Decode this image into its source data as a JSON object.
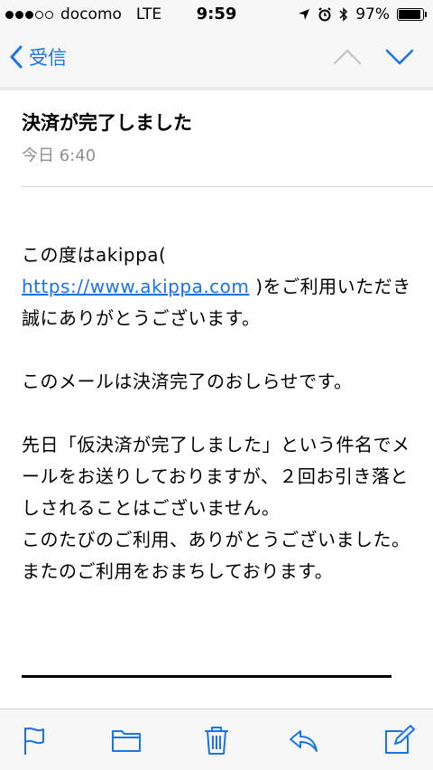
{
  "status_bar": {
    "carrier": "docomo",
    "network": "LTE",
    "time": "9:59",
    "battery": "97%",
    "signal_filled": 3,
    "signal_total": 5
  },
  "nav": {
    "back_label": "受信",
    "accent_color": "#1a73e8"
  },
  "message": {
    "subject": "決済が完了しました",
    "date": "今日 6:40",
    "body": {
      "p1_a": "この度はakippa(",
      "link": "https://www.akippa.com",
      "p1_b": ")をご利用いただき誠にありがとうございます。",
      "p2": "このメールは決済完了のおしらせです。",
      "p3": "先日「仮決済が完了しました」という件名でメールをお送りしておりますが、２回お引き落としされることはございません。",
      "p4": "このたびのご利用、ありがとうございました。またのご利用をおまちしております。"
    }
  },
  "toolbar": {
    "icons": [
      "flag-icon",
      "folder-icon",
      "trash-icon",
      "reply-icon",
      "compose-icon"
    ]
  }
}
